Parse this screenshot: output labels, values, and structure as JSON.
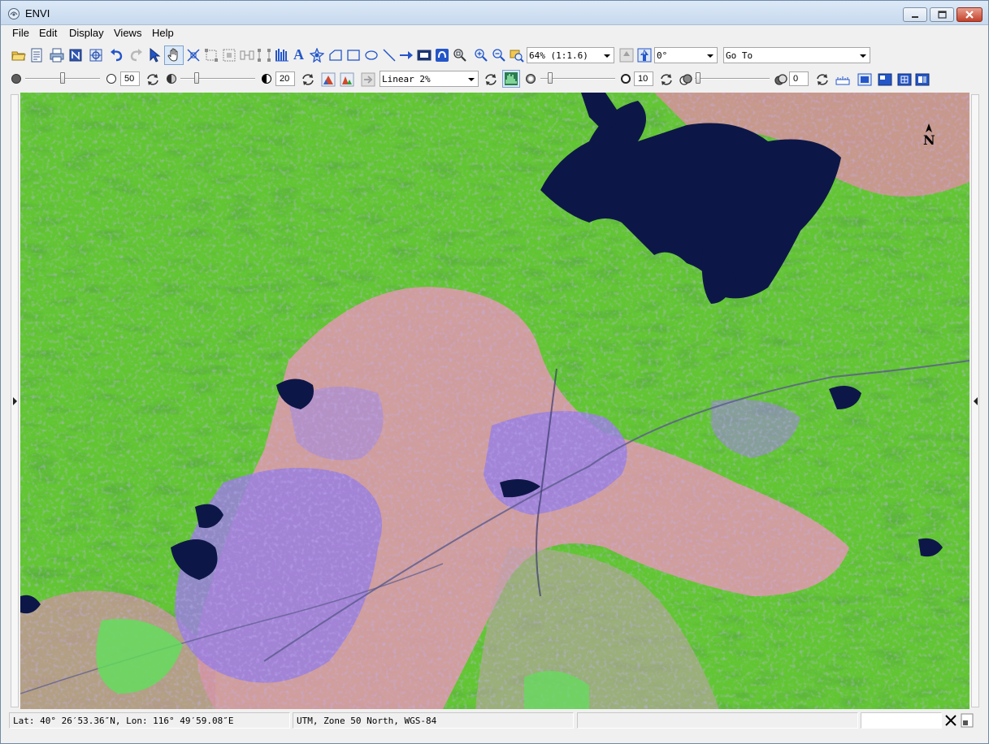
{
  "window": {
    "title": "ENVI"
  },
  "menu": [
    "File",
    "Edit",
    "Display",
    "Views",
    "Help"
  ],
  "toolbar": {
    "zoom_value": "64% (1:1.6)",
    "rotation_value": "0°",
    "goto_placeholder": "Go To",
    "icons": [
      "open-icon",
      "data-manager-icon",
      "print-icon",
      "export-icon",
      "layer-manager-icon",
      "undo-icon",
      "redo-icon",
      "select-icon",
      "pan-icon",
      "vertex-icon",
      "annotation-icon",
      "text-icon",
      "symbol-icon",
      "polygon-icon",
      "rectangle-icon",
      "ellipse-icon",
      "polyline-icon",
      "arrow-icon",
      "picture-icon",
      "fly-icon",
      "zoom-icon",
      "zoom-in-icon",
      "zoom-out-icon",
      "zoom-full-icon"
    ]
  },
  "toolbar2": {
    "brightness_value": "50",
    "contrast_value": "20",
    "stretch_value": "Linear 2%",
    "sharpen_value": "10",
    "transparency_value": "0"
  },
  "status": {
    "latlon": "Lat: 40° 26′53.36″N, Lon: 116° 49′59.08″E",
    "projection": "UTM, Zone 50 North, WGS-84",
    "extra": ""
  },
  "map": {
    "north_label": "N"
  },
  "colors": {
    "water": "#0d1747",
    "vegetation": "#5fc22f",
    "urban": "#9b7fe0",
    "bare": "#d9979c"
  }
}
